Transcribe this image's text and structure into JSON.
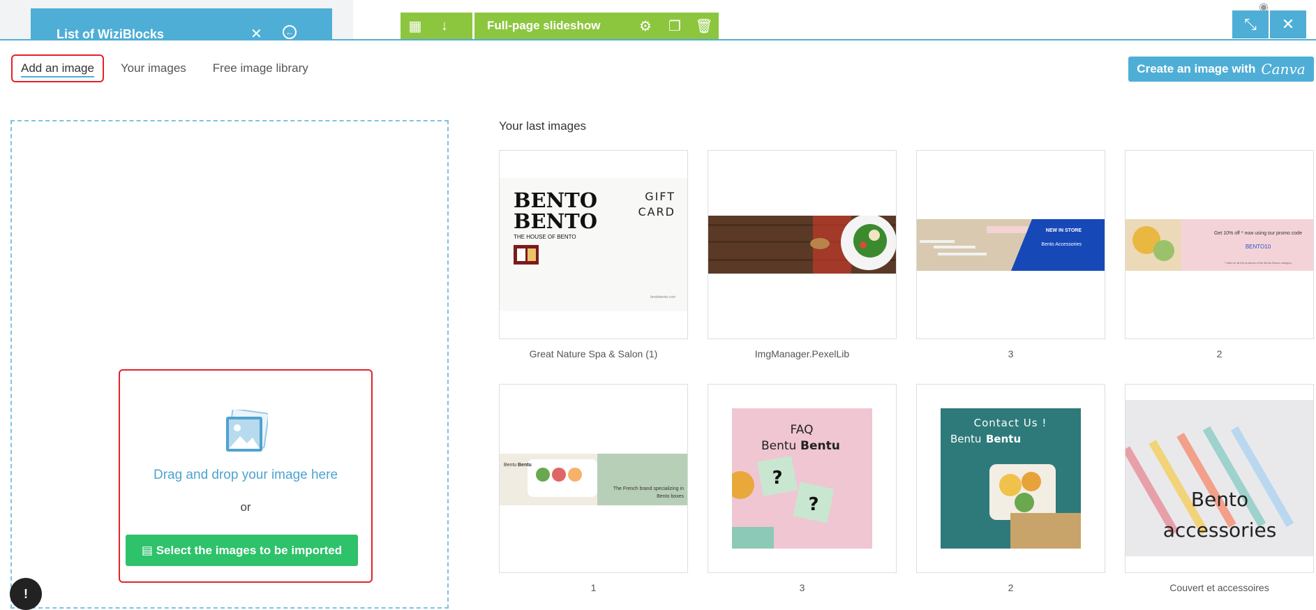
{
  "wiziblocks": {
    "title": "List of WiziBlocks"
  },
  "toolbar": {
    "block_label": "Full-page slideshow"
  },
  "tabs": [
    {
      "label": "Add an image",
      "active": true
    },
    {
      "label": "Your images",
      "active": false
    },
    {
      "label": "Free image library",
      "active": false
    }
  ],
  "canva": {
    "label": "Create an image with",
    "logo": "Canva"
  },
  "dropzone": {
    "drag_text": "Drag and drop your image here",
    "or_text": "or",
    "select_label": "Select the images to be imported"
  },
  "last_images": {
    "title": "Your last images",
    "items": [
      {
        "caption": "Great Nature Spa & Salon (1)"
      },
      {
        "caption": "ImgManager.PexelLib"
      },
      {
        "caption": "3"
      },
      {
        "caption": "2"
      },
      {
        "caption": "1"
      },
      {
        "caption": "3"
      },
      {
        "caption": "2"
      },
      {
        "caption": "Couvert et accessoires"
      }
    ]
  },
  "thumbnail_text": {
    "bento1": "BENTO",
    "bento2": "BENTO",
    "house": "THE HOUSE OF BENTO",
    "gift1": "GIFT",
    "gift2": "CARD",
    "site": "bentobento.com",
    "new_in_store": "NEW IN STORE",
    "bento_accessories": "Bento Accessories",
    "promo": "Get 10% off * now using our promo code",
    "code": "BENTO10",
    "promo_note": "* Valid on all the products of the Bento Boxes category.",
    "brand_bentu": "Bentu",
    "brand_bentu_bold": "Bentu",
    "french_brand1": "The French brand specializing in",
    "french_brand2": "Bento boxes",
    "faq": "FAQ",
    "bentu_a": "Bentu",
    "bentu_b": "Bentu",
    "q": "?",
    "contact": "Contact  Us !",
    "bentu_c": "Bentu",
    "bentu_d": "Bentu",
    "acc1": "Bento",
    "acc2": "accessories"
  },
  "colors": {
    "accent": "#4faed6",
    "toolbar_green": "#8cc63f",
    "select_green": "#2ec26a",
    "highlight_red": "#e2222a"
  }
}
